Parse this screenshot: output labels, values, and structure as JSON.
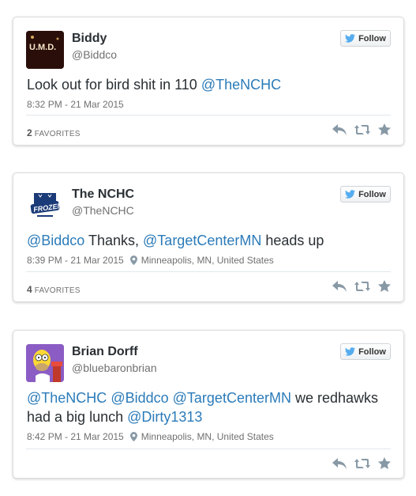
{
  "tweets": [
    {
      "name": "Biddy",
      "handle": "@Biddco",
      "text_plain": "Look out for bird shit in 110 ",
      "mention": "@TheNCHC",
      "timestamp": "8:32 PM - 21 Mar 2015",
      "favorites_count": "2",
      "favorites_label": "FAVORITES",
      "follow_label": "Follow",
      "avatar_text": "U.M.D."
    },
    {
      "name": "The NCHC",
      "handle": "@TheNCHC",
      "mention1": "@Biddco",
      "text_mid": " Thanks, ",
      "mention2": "@TargetCenterMN",
      "text_end": " heads up",
      "timestamp": "8:39 PM - 21 Mar 2015",
      "location": "Minneapolis, MN, United States",
      "favorites_count": "4",
      "favorites_label": "FAVORITES",
      "follow_label": "Follow",
      "avatar_text": "FROZEN"
    },
    {
      "name": "Brian Dorff",
      "handle": "@bluebaronbrian",
      "mention1": "@TheNCHC",
      "mention2": "@Biddco",
      "mention3": "@TargetCenterMN",
      "text_mid": " we redhawks had a big lunch ",
      "mention4": "@Dirty1313",
      "timestamp": "8:42 PM - 21 Mar 2015",
      "location": "Minneapolis, MN, United States",
      "follow_label": "Follow"
    }
  ],
  "icons": {
    "twitter_bird": "twitter-bird-icon",
    "reply": "reply-icon",
    "retweet": "retweet-icon",
    "favorite": "star-icon",
    "location": "location-pin-icon"
  },
  "colors": {
    "link": "#2b7bb9",
    "twitter_blue": "#55acee",
    "muted": "#707070",
    "action_icon": "#8899a6"
  }
}
